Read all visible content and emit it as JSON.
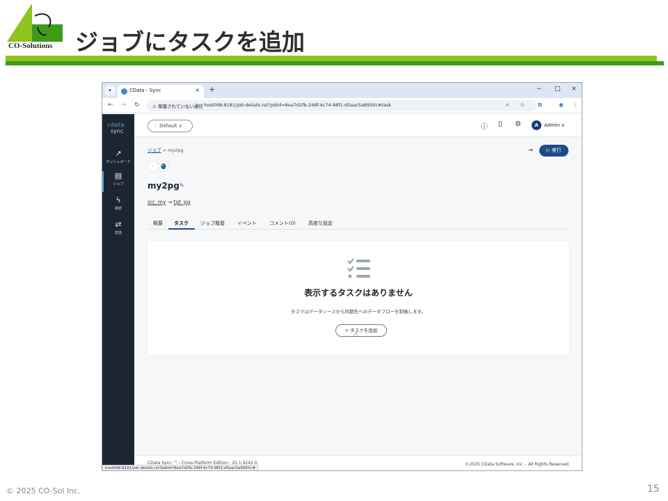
{
  "slide": {
    "logo_text": "CO-Solutions",
    "title": "ジョブにタスクを追加",
    "copyright": "© 2025 CO-Sol Inc.",
    "page_number": "15",
    "accent_light": "#8fc31f",
    "accent_dark": "#3d9b1a"
  },
  "browser": {
    "tab_title": "CData - Sync",
    "tab_close": "×",
    "new_tab": "+",
    "window_controls": [
      "−",
      "□",
      "×"
    ],
    "security_label": "⚠ 保護されていない通信",
    "url": "host098:8181/job-details.rst?jobid=8ea7d2fb-248f-4c74-98f1-d5aac5a8950c#task",
    "status_bar_url": "host098:8181/job-details.rst?jobid=8ea7d2fb-248f-4c74-98f1-d5aac5a8950c#"
  },
  "app": {
    "brand_top": "cdata",
    "brand_bottom": "sync",
    "sidebar": [
      {
        "icon": "↗",
        "label": "ダッシュボード"
      },
      {
        "icon": "▤",
        "label": "ジョブ"
      },
      {
        "icon": "ϟ",
        "label": "接続"
      },
      {
        "icon": "⇄",
        "label": "変換"
      }
    ],
    "workspace_selector": "⁘ Default ∨",
    "admin_initial": "A",
    "admin_name": "Admin ∨",
    "breadcrumb_parent": "ジョブ",
    "breadcrumb_sep": " > ",
    "breadcrumb_current": "my2pg",
    "run_button": "▷ 実行",
    "job_name": "my2pg",
    "source": "src_my",
    "arrow": " → ",
    "target": "tgt_pg",
    "tabs": [
      "概要",
      "タスク",
      "ジョブ履歴",
      "イベント",
      "コメント(0)",
      "高度な設定"
    ],
    "empty_title": "表示するタスクはありません",
    "empty_desc": "タスクはデータソースから同期先へのデータフローを制御します。",
    "add_task_button": "+ タスクを追加",
    "footer_left": "CData Sync ™ - Cross-Platform Edition - 25.1.9242.0",
    "footer_right": "©2025 CData Software, Inc. - All Rights Reserved.",
    "active_tab_color": "#1e4a8a",
    "sidebar_color": "#1d2630"
  }
}
